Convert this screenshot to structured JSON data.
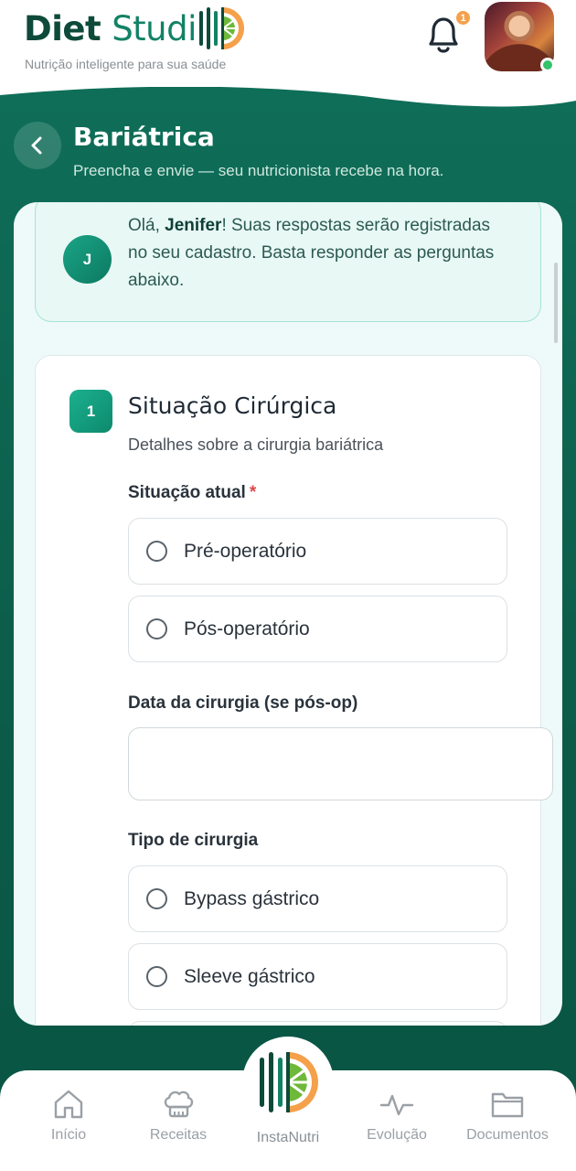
{
  "header": {
    "brand_part1": "Diet",
    "brand_part2": "Studi",
    "tagline": "Nutrição inteligente para sua saúde",
    "notification_count": "1"
  },
  "page": {
    "title": "Bariátrica",
    "subtitle": "Preencha e envie — seu nutricionista recebe na hora."
  },
  "greeting": {
    "avatar_initial": "J",
    "prefix": "Olá, ",
    "name": "Jenifer",
    "message": "! Suas respostas serão registradas no seu cadastro. Basta responder as perguntas abaixo."
  },
  "section": {
    "number": "1",
    "title": "Situação Cirúrgica",
    "description": "Detalhes sobre a cirurgia bariátrica"
  },
  "fields": {
    "situacao_label": "Situação atual",
    "required_mark": "*",
    "situacao_options": [
      "Pré-operatório",
      "Pós-operatório"
    ],
    "data_label": "Data da cirurgia (se pós-op)",
    "data_value": "",
    "tipo_label": "Tipo de cirurgia",
    "tipo_options": [
      "Bypass gástrico",
      "Sleeve gástrico"
    ]
  },
  "nav": {
    "items": [
      "Início",
      "Receitas",
      "InstaNutri",
      "Evolução",
      "Documentos"
    ]
  },
  "colors": {
    "brand_dark": "#0e4a3a",
    "brand_green": "#128265",
    "banner": "#0f6e58",
    "accent_orange": "#f5a04b"
  }
}
